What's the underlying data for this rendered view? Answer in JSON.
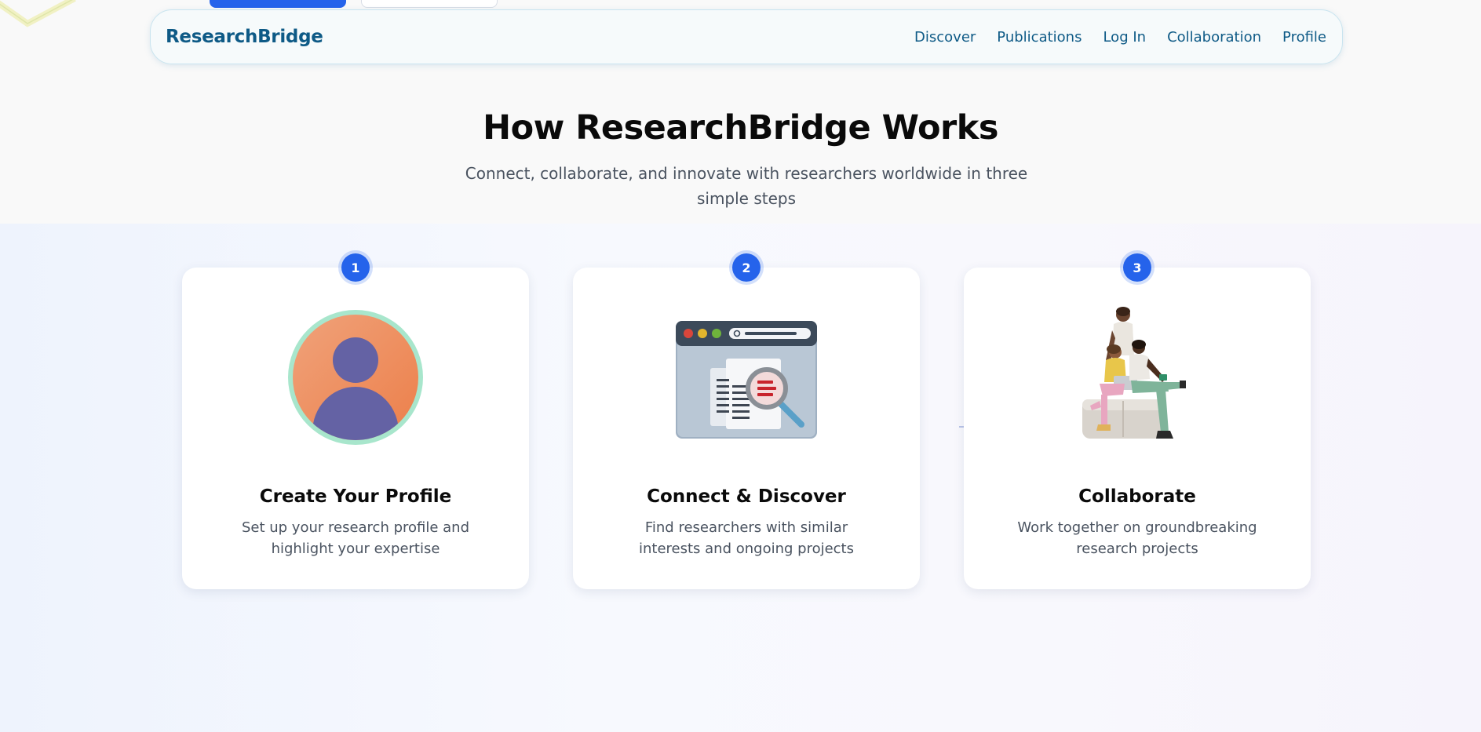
{
  "nav": {
    "brand": "ResearchBridge",
    "links": [
      "Discover",
      "Publications",
      "Log In",
      "Collaboration",
      "Profile"
    ]
  },
  "hero": {
    "title": "How ResearchBridge Works",
    "subtitle": "Connect, collaborate, and innovate with researchers worldwide in three simple steps"
  },
  "steps": [
    {
      "number": "1",
      "title": "Create Your Profile",
      "description": "Set up your research profile and highlight your expertise",
      "icon": "user-profile-icon"
    },
    {
      "number": "2",
      "title": "Connect & Discover",
      "description": "Find researchers with similar interests and ongoing projects",
      "icon": "browser-search-icon"
    },
    {
      "number": "3",
      "title": "Collaborate",
      "description": "Work together on groundbreaking research projects",
      "icon": "team-collaboration-illustration"
    }
  ],
  "colors": {
    "accent": "#2563eb",
    "brand": "#0e5a86",
    "text_muted": "#4a5360"
  }
}
